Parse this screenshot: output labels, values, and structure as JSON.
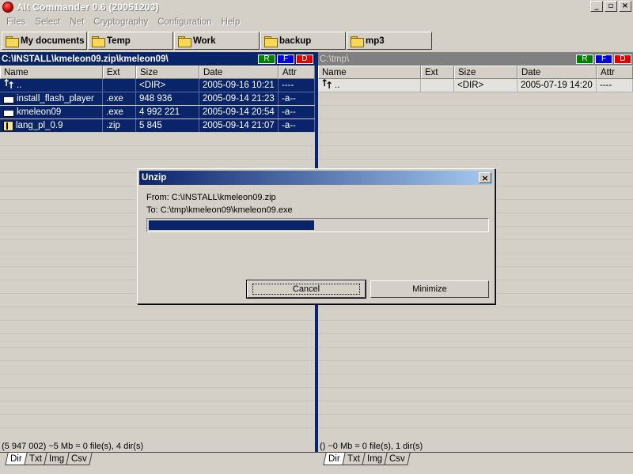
{
  "window": {
    "title": "Alt Commander 0.6 (20051203)",
    "minimize": "_",
    "maximize": "▫",
    "close": "×"
  },
  "menu": [
    "Files",
    "Select",
    "Net",
    "Cryptography",
    "Configuration",
    "Help"
  ],
  "bookmarks": [
    "My documents",
    "Temp",
    "Work",
    "backup",
    "mp3"
  ],
  "columns": [
    "Name",
    "Ext",
    "Size",
    "Date",
    "Attr"
  ],
  "flags": {
    "r": "R",
    "f": "F",
    "d": "D"
  },
  "left_panel": {
    "path": "C:\\INSTALL\\kmeleon09.zip\\kmeleon09\\",
    "rows": [
      {
        "icon": "up-dir-icon",
        "name": "..",
        "ext": "",
        "size": "<DIR>",
        "date": "2005-09-16 10:21",
        "attr": "----"
      },
      {
        "icon": "file-icon",
        "name": "install_flash_player",
        "ext": ".exe",
        "size": "948 936",
        "date": "2005-09-14 21:23",
        "attr": "-a--"
      },
      {
        "icon": "file-icon",
        "name": "kmeleon09",
        "ext": ".exe",
        "size": "4 992 221",
        "date": "2005-09-14 20:54",
        "attr": "-a--"
      },
      {
        "icon": "zip-icon",
        "name": "lang_pl_0.9",
        "ext": ".zip",
        "size": "5 845",
        "date": "2005-09-14 21:07",
        "attr": "-a--"
      }
    ],
    "status": "(5 947 002) ~5 Mb = 0 file(s), 4 dir(s)"
  },
  "right_panel": {
    "path": "C:\\tmp\\",
    "rows": [
      {
        "icon": "up-dir-icon",
        "name": "..",
        "ext": "",
        "size": "<DIR>",
        "date": "2005-07-19 14:20",
        "attr": "----"
      }
    ],
    "status": "() ~0 Mb = 0 file(s), 1 dir(s)"
  },
  "tabs": [
    "Dir",
    "Txt",
    "Img",
    "Csv"
  ],
  "dialog": {
    "title": "Unzip",
    "from": "From: C:\\INSTALL\\kmeleon09.zip",
    "to": "To: C:\\tmp\\kmeleon09\\kmeleon09.exe",
    "progress": 0.49,
    "cancel": "Cancel",
    "minimize": "Minimize",
    "close": "×"
  }
}
